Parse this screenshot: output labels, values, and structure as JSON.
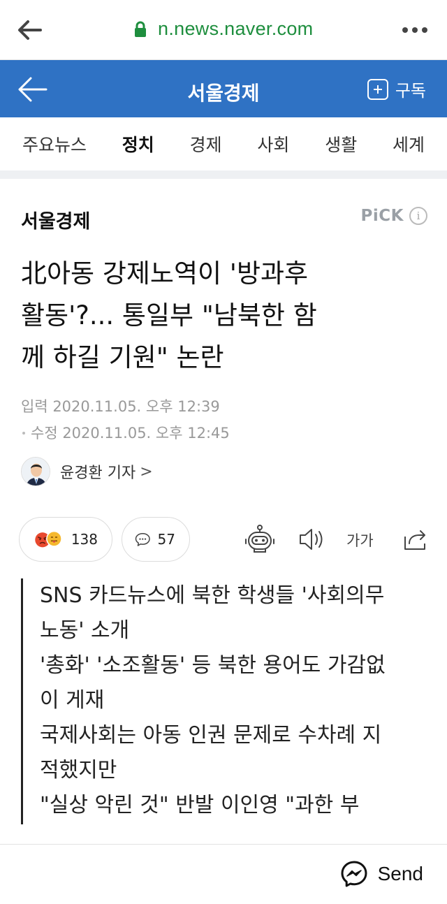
{
  "browser": {
    "url": "n.news.naver.com"
  },
  "header": {
    "title": "서울경제",
    "subscribe_label": "구독"
  },
  "tabs": [
    {
      "label": "주요뉴스",
      "active": false
    },
    {
      "label": "정치",
      "active": true
    },
    {
      "label": "경제",
      "active": false
    },
    {
      "label": "사회",
      "active": false
    },
    {
      "label": "생활",
      "active": false
    },
    {
      "label": "세계",
      "active": false
    }
  ],
  "article": {
    "press": "서울경제",
    "pick_label": "PiCK",
    "pick_info": "i",
    "headline_lines": [
      "北아동 강제노역이 '방과후",
      "활동'?... 통일부 \"남북한 함",
      "께 하길 기원\" 논란"
    ],
    "published": "입력 2020.11.05. 오후 12:39",
    "modified": "수정 2020.11.05. 오후 12:45",
    "reporter": "윤경환 기자",
    "reporter_chevron": ">",
    "reactions_count": "138",
    "comments_count": "57",
    "font_size_label": "가가",
    "summary_lines": [
      "SNS 카드뉴스에 북한 학생들 '사회의무",
      "노동' 소개",
      "'총화' '소조활동' 등 북한 용어도 가감없",
      "이 게재",
      "국제사회는 아동 인권 문제로 수차례 지",
      "적했지만",
      "\"실상 악린 것\" 반발 이인영 \"과한 부"
    ]
  },
  "send_bar": {
    "label": "Send"
  },
  "colors": {
    "header_bg": "#2f72c4",
    "url_green": "#1e8e3e",
    "angry_red": "#e8492e",
    "smile_yellow": "#f5b82e"
  }
}
